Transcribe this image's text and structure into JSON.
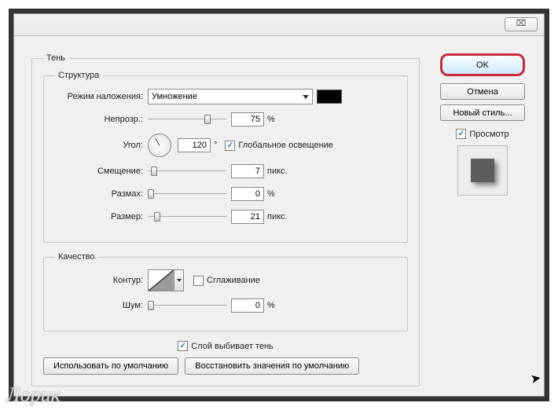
{
  "titlebar": {
    "close_glyph": "⌧"
  },
  "main_group": "Тень",
  "structure": {
    "legend": "Структура",
    "blend_mode": {
      "label": "Режим наложения:",
      "value": "Умножение"
    },
    "opacity": {
      "label": "Непрозр.:",
      "value": "75",
      "unit": "%",
      "thumb_pct": 72
    },
    "angle": {
      "label": "Угол:",
      "value": "120",
      "degree": "°",
      "global_label": "Глобальное освещение",
      "global_checked": true
    },
    "distance": {
      "label": "Смещение:",
      "value": "7",
      "unit": "пикс.",
      "thumb_pct": 4
    },
    "spread": {
      "label": "Размах:",
      "value": "0",
      "unit": "%",
      "thumb_pct": 0
    },
    "size": {
      "label": "Размер:",
      "value": "21",
      "unit": "пикс.",
      "thumb_pct": 8
    }
  },
  "quality": {
    "legend": "Качество",
    "contour": {
      "label": "Контур:",
      "antialias_label": "Сглаживание",
      "antialias_checked": false
    },
    "noise": {
      "label": "Шум:",
      "value": "0",
      "unit": "%",
      "thumb_pct": 0
    }
  },
  "layer_knocks": {
    "label": "Слой выбивает тень",
    "checked": true
  },
  "buttons": {
    "ok": "OK",
    "cancel": "Отмена",
    "new_style": "Новый стиль...",
    "preview_label": "Просмотр",
    "preview_checked": true,
    "make_default": "Использовать по умолчанию",
    "reset_default": "Восстановить значения по умолчанию"
  },
  "watermark": "Лорик"
}
